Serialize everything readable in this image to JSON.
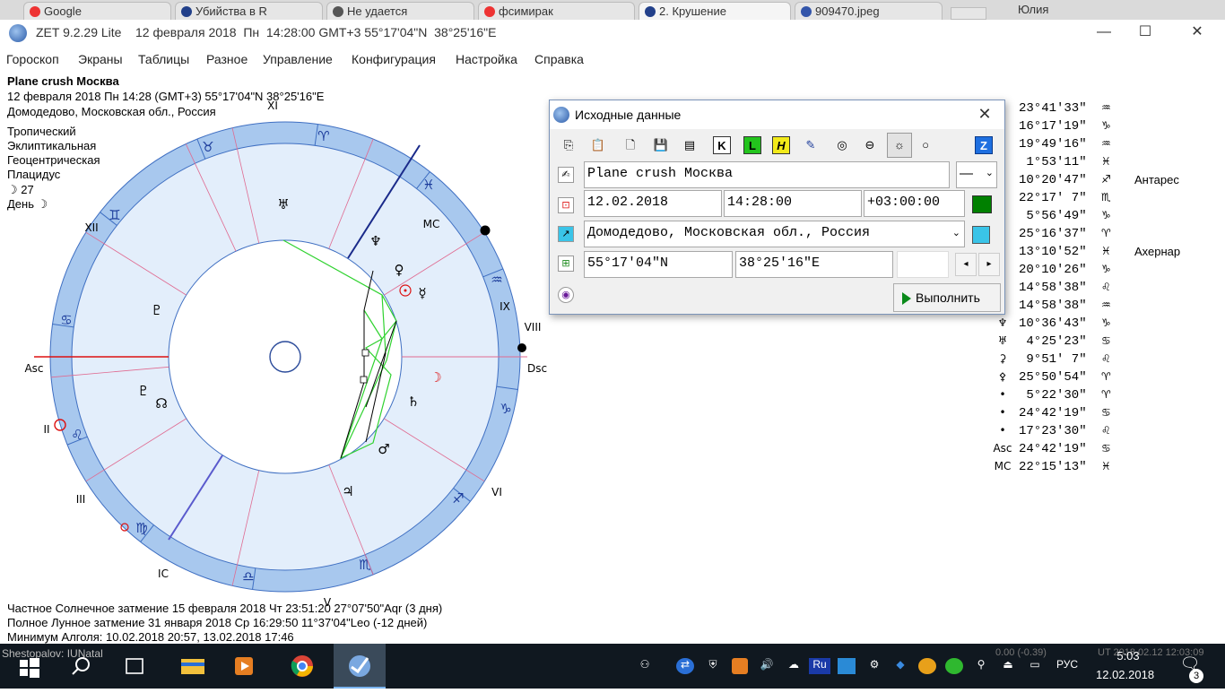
{
  "browser_tabs": [
    {
      "label": "Google",
      "color": "#e33"
    },
    {
      "label": "Убийства в R",
      "color": "#22408a"
    },
    {
      "label": "Не удается",
      "color": "#555"
    },
    {
      "label": "фсимирак",
      "color": "#e33"
    },
    {
      "label": "2. Крушение",
      "color": "#22408a"
    },
    {
      "label": "909470.jpeg",
      "color": "#3355aa"
    }
  ],
  "browser_user": "Юлия",
  "window": {
    "title": "ZET 9.2.29 Lite    12 февраля 2018  Пн  14:28:00 GMT+3 55°17'04\"N  38°25'16\"E",
    "minimize": "—",
    "maximize": "☐",
    "close": "✕"
  },
  "menu": [
    "Гороскоп",
    "Экраны",
    "Таблицы",
    "Разное",
    "Управление",
    "Конфигурация",
    "Настройка",
    "Справка"
  ],
  "chart_info": {
    "title": "Plane crush Москва",
    "date_line": "12 февраля 2018  Пн   14:28 (GMT+3) 55°17'04\"N  38°25'16\"E",
    "place": "Домодедово, Московская обл., Россия",
    "settings": [
      "Тропический",
      "Эклиптикальная",
      "Геоцентрическая",
      "Плацидус",
      "☽  27",
      "День ☽"
    ]
  },
  "wheel": {
    "houses": [
      "XI",
      "MC",
      "IX",
      "VIII",
      "Dsc",
      "VI",
      "V",
      "IC",
      "III",
      "II",
      "Asc",
      "XII"
    ],
    "signs": [
      "♉",
      "♈",
      "♓",
      "♒",
      "♑",
      "♐",
      "♏",
      "♎",
      "♍",
      "♌",
      "♋",
      "♊"
    ],
    "planet_glyphs": [
      "♅",
      "♆",
      "♀",
      "☿",
      "⊙",
      "☽",
      "♇",
      "♄",
      "♂",
      "♃",
      "♇",
      "☊"
    ]
  },
  "planet_table": [
    {
      "sym": "",
      "pos": "23°41'33\"",
      "sign": "♒",
      "star": ""
    },
    {
      "sym": "",
      "pos": "16°17'19\"",
      "sign": "♑",
      "star": ""
    },
    {
      "sym": "",
      "pos": "19°49'16\"",
      "sign": "♒",
      "star": ""
    },
    {
      "sym": "",
      "pos": " 1°53'11\"",
      "sign": "♓",
      "star": ""
    },
    {
      "sym": "",
      "pos": "10°20'47\"",
      "sign": "♐",
      "star": "Антарес"
    },
    {
      "sym": "",
      "pos": "22°17' 7\"",
      "sign": "♏",
      "star": ""
    },
    {
      "sym": "",
      "pos": " 5°56'49\"",
      "sign": "♑",
      "star": ""
    },
    {
      "sym": "",
      "pos": "25°16'37\"",
      "sign": "♈",
      "star": ""
    },
    {
      "sym": "",
      "pos": "13°10'52\"",
      "sign": "♓",
      "star": "Ахернар"
    },
    {
      "sym": "",
      "pos": "20°10'26\"",
      "sign": "♑",
      "star": ""
    },
    {
      "sym": "",
      "pos": "14°58'38\"",
      "sign": "♌",
      "star": ""
    },
    {
      "sym": "",
      "pos": "14°58'38\"",
      "sign": "♒",
      "star": ""
    },
    {
      "sym": "♆",
      "pos": "10°36'43\"",
      "sign": "♑",
      "star": ""
    },
    {
      "sym": "♅",
      "pos": " 4°25'23\"",
      "sign": "♋",
      "star": ""
    },
    {
      "sym": "⚳",
      "pos": " 9°51' 7\"",
      "sign": "♌",
      "star": ""
    },
    {
      "sym": "⚴",
      "pos": "25°50'54\"",
      "sign": "♈",
      "star": ""
    },
    {
      "sym": "•",
      "pos": " 5°22'30\"",
      "sign": "♈",
      "star": ""
    },
    {
      "sym": "•",
      "pos": "24°42'19\"",
      "sign": "♋",
      "star": ""
    },
    {
      "sym": "•",
      "pos": "17°23'30\"",
      "sign": "♌",
      "star": ""
    },
    {
      "sym": "Asc",
      "pos": "24°42'19\"",
      "sign": "♋",
      "star": ""
    },
    {
      "sym": "MC",
      "pos": "22°15'13\"",
      "sign": "♓",
      "star": ""
    }
  ],
  "dialog": {
    "title": "Исходные данные",
    "close": "✕",
    "name_value": "Plane crush Москва",
    "type_value": "—",
    "date_value": "12.02.2018",
    "time_value": "14:28:00",
    "tz_value": "+03:00:00",
    "tz_color": "#008000",
    "place_value": "Домодедово, Московская обл., Россия",
    "lat_value": "55°17'04\"N",
    "lon_value": " 38°25'16\"E",
    "extra_value": "",
    "run_label": "Выполнить",
    "toolbar_labels": [
      "K",
      "L",
      "H",
      "Z"
    ]
  },
  "bottom_lines": [
    "Частное Солнечное затмение 15 февраля 2018 Чт 23:51:20 27°07'50\"Aqr (3 дня)",
    "Полное Лунное затмение 31 января 2018 Ср 16:29:50 11°37'04\"Leo (-12 дней)",
    "Минимум Алголя: 10.02.2018 20:57,  13.02.2018 17:46"
  ],
  "status_overlay": "Shestopalov: IUNatal",
  "tray": {
    "lang": "РУС",
    "time": "5:03",
    "date": "12.02.2018",
    "notif_count": "3",
    "ime": "Ru",
    "status_left": "0.00 (-0.39)",
    "status_right": "UT 2018.02.12 12:03:09"
  }
}
